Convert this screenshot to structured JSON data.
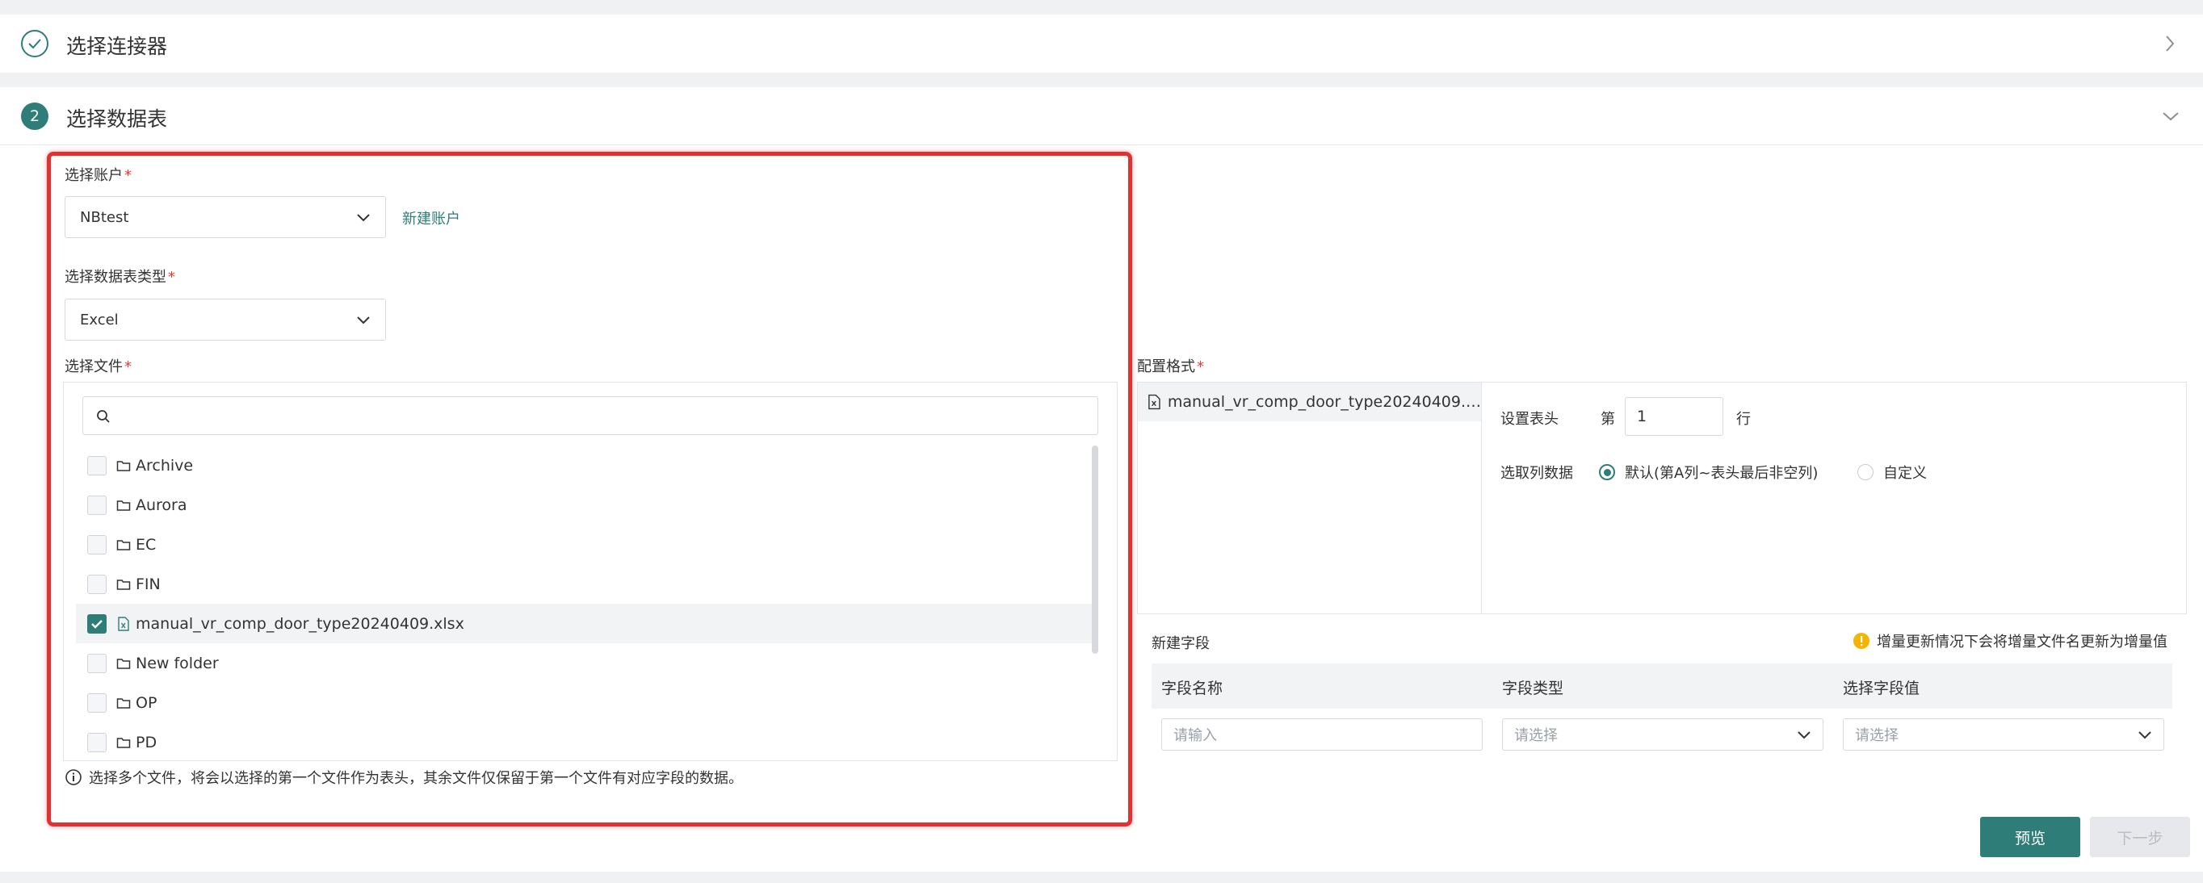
{
  "steps": {
    "step1": {
      "title": "选择连接器",
      "icon": "check-icon"
    },
    "step2": {
      "number": "2",
      "title": "选择数据表"
    }
  },
  "account": {
    "label": "选择账户",
    "required_mark": "*",
    "value": "NBtest",
    "new_link": "新建账户"
  },
  "table_type": {
    "label": "选择数据表类型",
    "required_mark": "*",
    "value": "Excel"
  },
  "file_select": {
    "label": "选择文件",
    "required_mark": "*",
    "search_placeholder": "",
    "items": [
      {
        "name": "Archive",
        "type": "folder",
        "checked": false
      },
      {
        "name": "Aurora",
        "type": "folder",
        "checked": false
      },
      {
        "name": "EC",
        "type": "folder",
        "checked": false
      },
      {
        "name": "FIN",
        "type": "folder",
        "checked": false
      },
      {
        "name": "manual_vr_comp_door_type20240409.xlsx",
        "type": "file",
        "checked": true
      },
      {
        "name": "New folder",
        "type": "folder",
        "checked": false
      },
      {
        "name": "OP",
        "type": "folder",
        "checked": false
      },
      {
        "name": "PD",
        "type": "folder",
        "checked": false
      }
    ],
    "hint": "选择多个文件，将会以选择的第一个文件作为表头，其余文件仅保留于第一个文件有对应字段的数据。"
  },
  "config": {
    "label": "配置格式",
    "required_mark": "*",
    "file_tab": "manual_vr_comp_door_type20240409.…",
    "header_row": {
      "label": "设置表头",
      "prefix": "第",
      "value": "1",
      "suffix": "行"
    },
    "column_data": {
      "label": "选取列数据",
      "options": [
        {
          "label": "默认(第A列~表头最后非空列)",
          "selected": true
        },
        {
          "label": "自定义",
          "selected": false
        }
      ]
    }
  },
  "new_field": {
    "title": "新建字段",
    "warning": "增量更新情况下会将增量文件名更新为增量值",
    "columns": [
      "字段名称",
      "字段类型",
      "选择字段值"
    ],
    "row": {
      "name_placeholder": "请输入",
      "type_placeholder": "请选择",
      "value_placeholder": "请选择"
    }
  },
  "buttons": {
    "preview": "预览",
    "next": "下一步"
  },
  "colors": {
    "accent": "#2f7d79",
    "highlight_box": "#e03232",
    "warning": "#f5b400"
  }
}
